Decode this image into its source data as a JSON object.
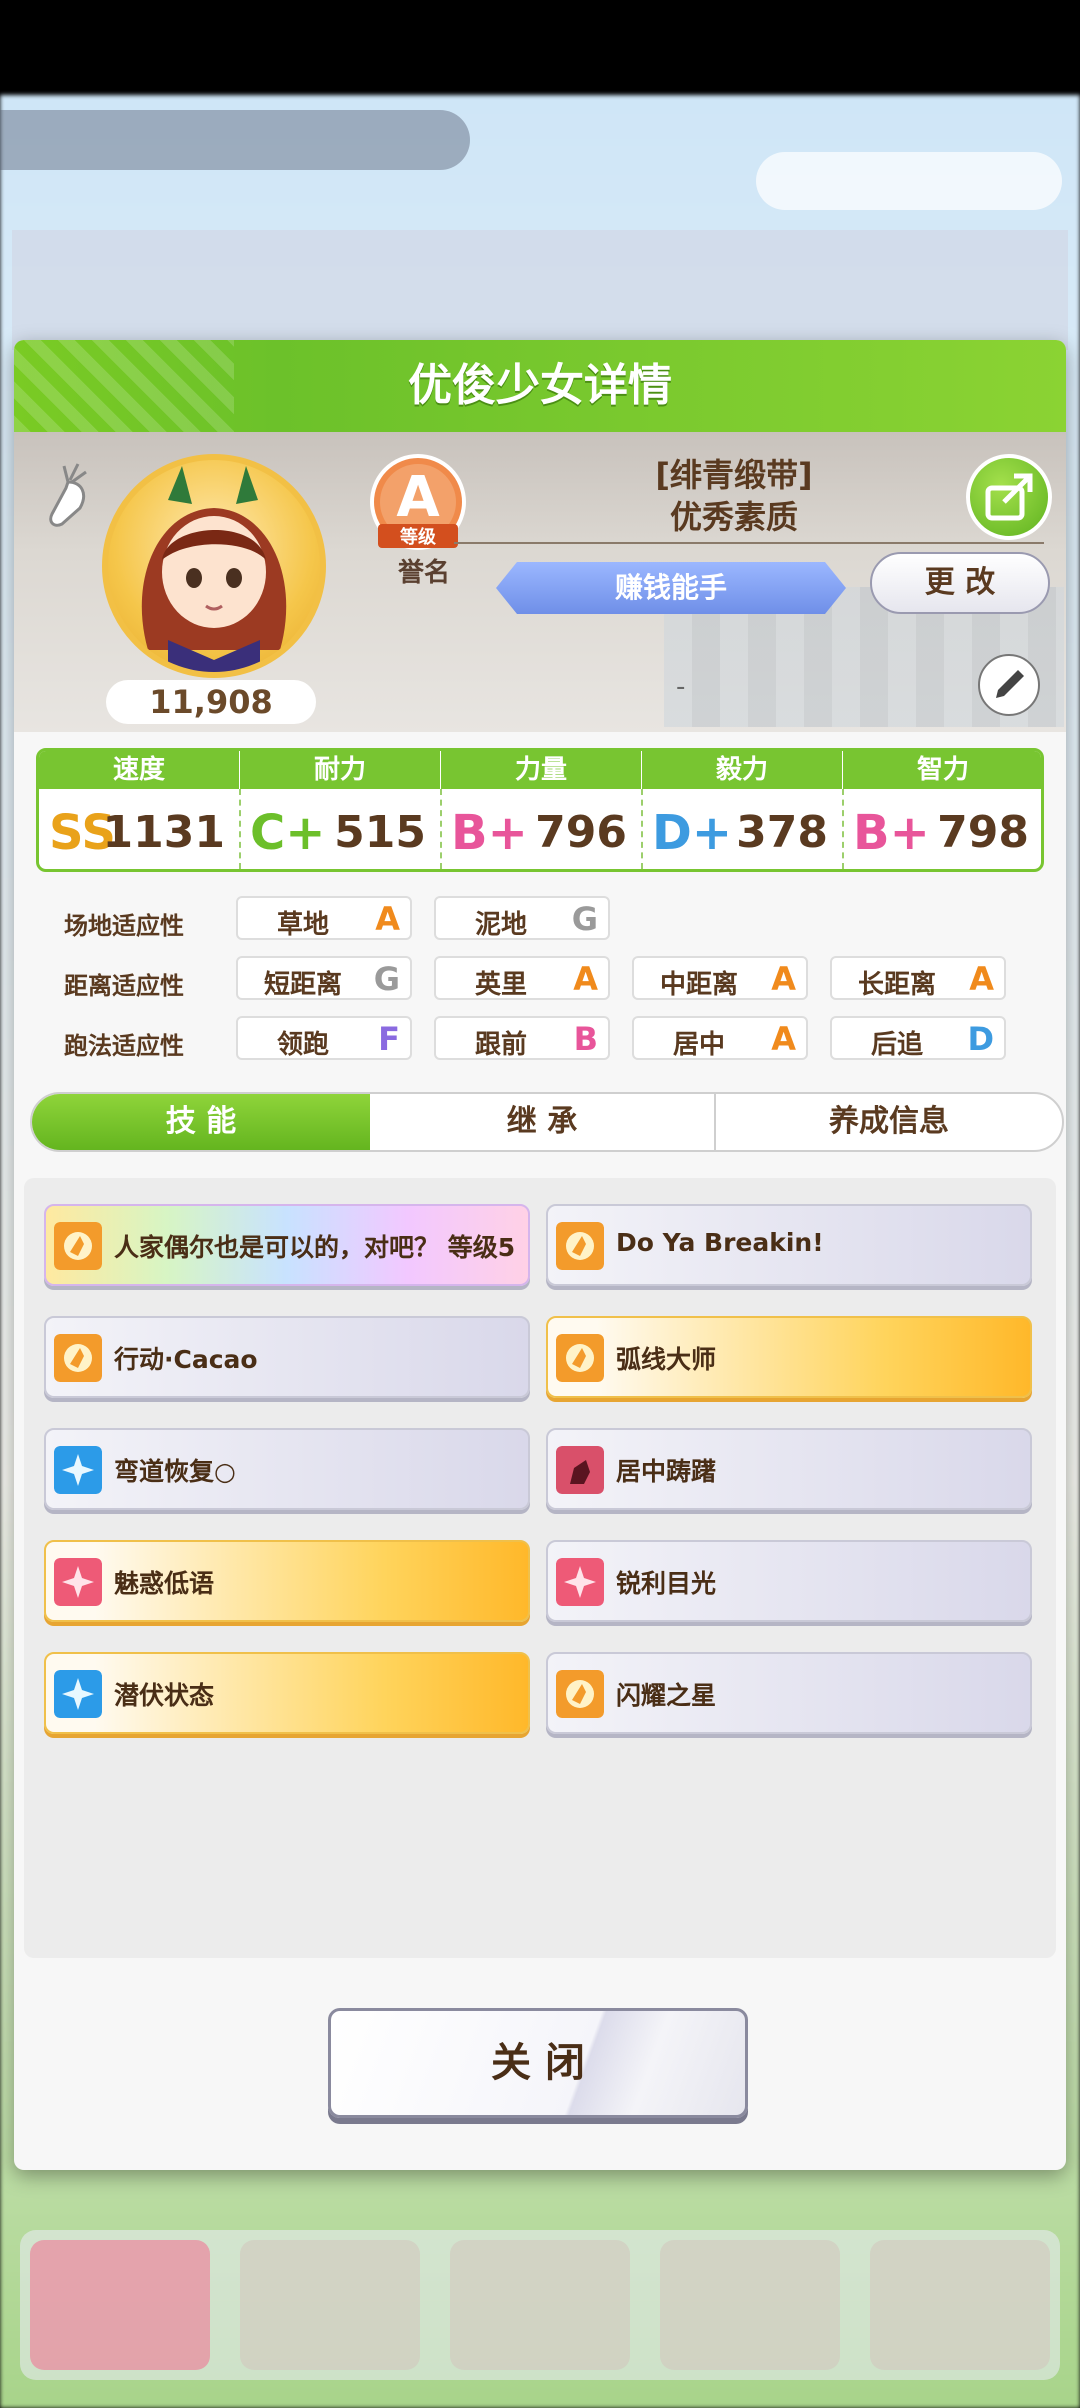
{
  "background": {
    "banner_text": "",
    "button_text": ""
  },
  "dialog": {
    "title": "优俊少女详情",
    "character": {
      "fans": "11,908",
      "grade_letter": "A",
      "grade_label": "等级",
      "rank_label": "誉名",
      "epithet_line1": "[绯青缎带]",
      "epithet_line2": "优秀素质",
      "title_banner": "赚钱能手",
      "change_button": "更 改",
      "dash": "-"
    },
    "stats": [
      {
        "name": "速度",
        "grade": "SS",
        "value": "1131",
        "color": "#e9a21a"
      },
      {
        "name": "耐力",
        "grade": "C+",
        "value": "515",
        "color": "#6cbf2a"
      },
      {
        "name": "力量",
        "grade": "B+",
        "value": "796",
        "color": "#e8559a"
      },
      {
        "name": "毅力",
        "grade": "D+",
        "value": "378",
        "color": "#3d9be0"
      },
      {
        "name": "智力",
        "grade": "B+",
        "value": "798",
        "color": "#e8559a"
      }
    ],
    "aptitude": {
      "labels": [
        "场地适应性",
        "距离适应性",
        "跑法适应性"
      ],
      "track": [
        {
          "name": "草地",
          "grade": "A",
          "color": "#f08a1c"
        },
        {
          "name": "泥地",
          "grade": "G",
          "color": "#9a9a9a"
        }
      ],
      "distance": [
        {
          "name": "短距离",
          "grade": "G",
          "color": "#9a9a9a"
        },
        {
          "name": "英里",
          "grade": "A",
          "color": "#f08a1c"
        },
        {
          "name": "中距离",
          "grade": "A",
          "color": "#f08a1c"
        },
        {
          "name": "长距离",
          "grade": "A",
          "color": "#f08a1c"
        }
      ],
      "style": [
        {
          "name": "领跑",
          "grade": "F",
          "color": "#8a6ae0"
        },
        {
          "name": "跟前",
          "grade": "B",
          "color": "#e8559a"
        },
        {
          "name": "居中",
          "grade": "A",
          "color": "#f08a1c"
        },
        {
          "name": "后追",
          "grade": "D",
          "color": "#3d9be0"
        }
      ]
    },
    "tabs": [
      {
        "label": "技 能",
        "active": true
      },
      {
        "label": "继 承",
        "active": false
      },
      {
        "label": "养成信息",
        "active": false
      }
    ],
    "skills": [
      {
        "text": "人家偶尔也是可以的，对吧？ 等级5",
        "style": "rainbow",
        "icon": "speed-icon"
      },
      {
        "text": "Do Ya Breakin!",
        "style": "white",
        "icon": "speed-icon"
      },
      {
        "text": "行动·Cacao",
        "style": "white",
        "icon": "speed-icon"
      },
      {
        "text": "弧线大师",
        "style": "gold",
        "icon": "speed-icon"
      },
      {
        "text": "弯道恢复○",
        "style": "white",
        "icon": "recovery-icon"
      },
      {
        "text": "居中踌躇",
        "style": "white",
        "icon": "debuff-icon"
      },
      {
        "text": "魅惑低语",
        "style": "gold",
        "icon": "sparkle-icon"
      },
      {
        "text": "锐利目光",
        "style": "white",
        "icon": "sparkle-icon"
      },
      {
        "text": "潜伏状态",
        "style": "gold",
        "icon": "recovery-icon"
      },
      {
        "text": "闪耀之星",
        "style": "white",
        "icon": "speed-icon"
      }
    ],
    "close_button": "关 闭"
  }
}
